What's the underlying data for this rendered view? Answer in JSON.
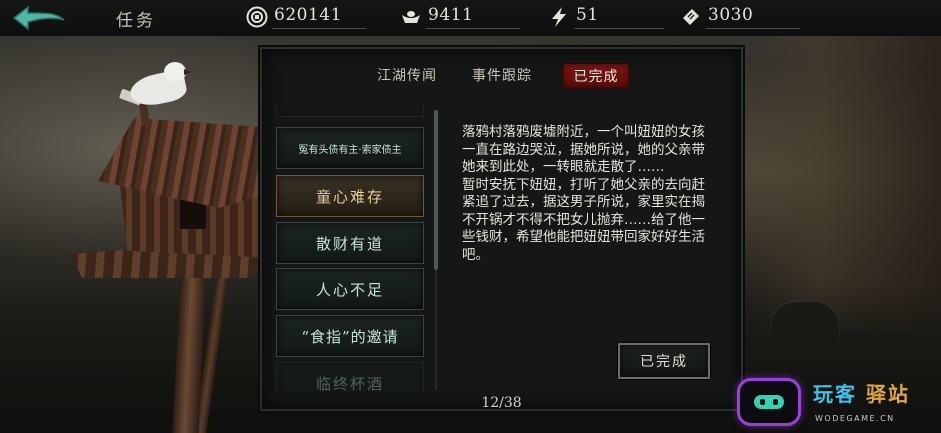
{
  "header": {
    "title": "任务",
    "back_icon": "back-arrow-icon",
    "resources": [
      {
        "icon": "coin-icon",
        "value": "620141"
      },
      {
        "icon": "silver-ingot-icon",
        "value": "9411"
      },
      {
        "icon": "lightning-icon",
        "value": "51"
      },
      {
        "icon": "ticket-icon",
        "value": "3030"
      }
    ]
  },
  "tabs": [
    {
      "label": "江湖传闻",
      "active": false
    },
    {
      "label": "事件跟踪",
      "active": false
    },
    {
      "label": "已完成",
      "active": true
    }
  ],
  "quests": [
    {
      "label": "",
      "state": "partial-top"
    },
    {
      "label": "冤有头债有主·索家债主",
      "state": "normal"
    },
    {
      "label": "童心难存",
      "state": "active"
    },
    {
      "label": "散财有道",
      "state": "normal"
    },
    {
      "label": "人心不足",
      "state": "normal"
    },
    {
      "label": "“食指”的邀请",
      "state": "normal"
    },
    {
      "label": "临终杯酒",
      "state": "partial-bottom"
    }
  ],
  "detail": {
    "paragraphs": [
      "落鸦村落鸦废墟附近，一个叫妞妞的女孩一直在路边哭泣，据她所说，她的父亲带她来到此处，一转眼就走散了……",
      "暂时安抚下妞妞，打听了她父亲的去向赶紧追了过去，据这男子所说，家里实在揭不开锅才不得不把女儿抛弃……给了他一些钱财，希望他能把妞妞带回家好好生活吧。"
    ],
    "button_label": "已完成"
  },
  "pager": "12/38",
  "watermark": {
    "name_a": "玩客",
    "name_b": "驿站",
    "site": "WODEGAME.CN"
  },
  "colors": {
    "active_tab": "#7a1613",
    "active_item_text": "#e7cf9a",
    "item_text": "#c7e3d9",
    "watermark_border": "#9a40d8"
  }
}
